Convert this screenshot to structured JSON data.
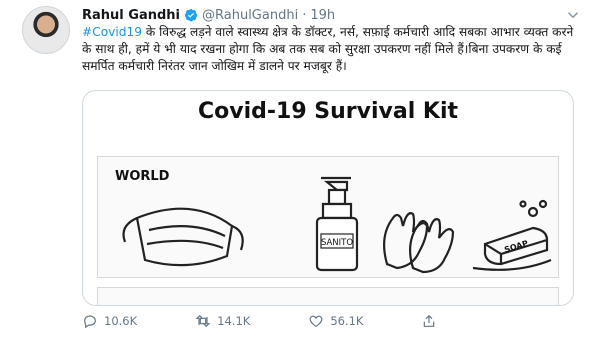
{
  "author": {
    "name": "Rahul Gandhi",
    "handle": "@RahulGandhi",
    "separator": "·",
    "time": "19h"
  },
  "tweet": {
    "hashtag": "#Covid19",
    "body": " के विरुद्ध लड़ने वाले स्वास्थ्य क्षेत्र के डॉक्टर, नर्स, सफ़ाई कर्मचारी आदि सबका आभार व्यक्त करने के साथ ही, हमें ये भी याद रखना होगा कि अब तक सब को सुरक्षा उपकरण नहीं मिले हैं।बिना उपकरण के कई समर्पित कर्मचारी निरंतर जान जोखिम में डालने पर मजबूर हैं।"
  },
  "media": {
    "title": "Covid-19 Survival Kit",
    "panel_label": "WORLD",
    "sanitizer_label": "SANITO",
    "soap_label": "SOAP"
  },
  "actions": {
    "replies": "10.6K",
    "retweets": "14.1K",
    "likes": "56.1K"
  },
  "colors": {
    "link": "#1b95e0",
    "verified": "#1da1f2",
    "muted": "#657786"
  }
}
